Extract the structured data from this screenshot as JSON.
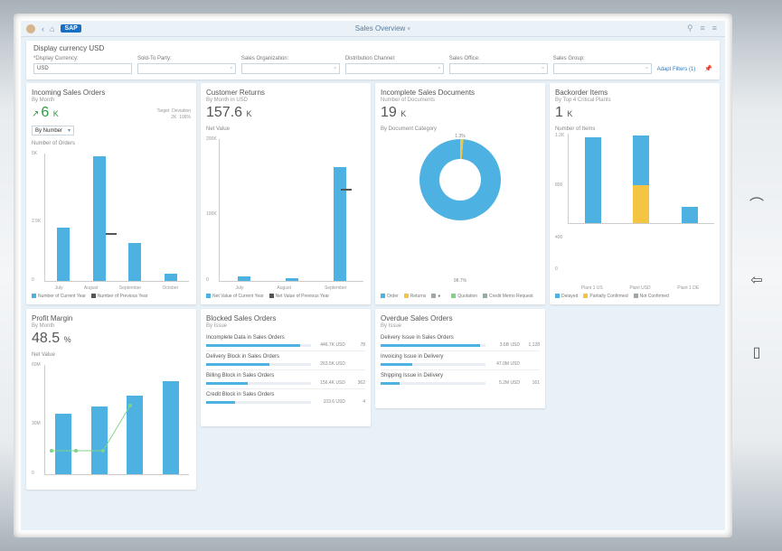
{
  "topbar": {
    "title": "Sales Overview",
    "sap": "SAP"
  },
  "filterbar": {
    "header": "Display currency USD",
    "fields": [
      {
        "label": "*Display Currency:",
        "value": "USD"
      },
      {
        "label": "Sold-To Party:",
        "value": ""
      },
      {
        "label": "Sales Organization:",
        "value": ""
      },
      {
        "label": "Distribution Channel:",
        "value": ""
      },
      {
        "label": "Sales Office:",
        "value": ""
      },
      {
        "label": "Sales Group:",
        "value": ""
      }
    ],
    "adapt": "Adapt Filters (1)"
  },
  "cards": {
    "incoming": {
      "title": "Incoming Sales Orders",
      "sub": "By Month",
      "kpi": "6",
      "unit": "K",
      "meta_labels": [
        "Target",
        "Deviation"
      ],
      "meta_values": [
        "2K",
        "196%"
      ],
      "selector": "By Number",
      "axis_label": "Number of Orders",
      "yticks": [
        "5K",
        "2.5K",
        "0"
      ],
      "bars": [
        {
          "l": "July",
          "v": 42
        },
        {
          "l": "August",
          "v": 98
        },
        {
          "l": "September",
          "v": 30
        },
        {
          "l": "October",
          "v": 6
        }
      ],
      "legend": [
        "Number of Current Year",
        "Number of Previous Year"
      ]
    },
    "returns": {
      "title": "Customer Returns",
      "sub": "By Month in USD",
      "kpi": "157.6",
      "unit": "K",
      "axis_label": "Net Value",
      "yticks": [
        "200K",
        "100K",
        "0"
      ],
      "bars": [
        {
          "l": "July",
          "v": 3
        },
        {
          "l": "August",
          "v": 2
        },
        {
          "l": "September",
          "v": 80
        }
      ],
      "legend": [
        "Net Value of Current Year",
        "Net Value of Previous Year"
      ]
    },
    "incomplete": {
      "title": "Incomplete Sales Documents",
      "sub": "Number of Documents",
      "kpi": "19",
      "unit": "K",
      "axis_label": "By Document Category",
      "slices": [
        {
          "label": "98.7%"
        },
        {
          "label": "1.3%"
        }
      ],
      "legend": [
        "Order",
        "Returns",
        "Quotation",
        "Credit Memo Request"
      ]
    },
    "backorder": {
      "title": "Backorder Items",
      "sub": "By Top 4 Critical Plants",
      "kpi": "1",
      "unit": "K",
      "axis_label": "Number of Items",
      "yticks": [
        "1.2K",
        "800",
        "400",
        "0"
      ],
      "cols": [
        {
          "l": "Plant 1 US",
          "b": 95,
          "y": 0
        },
        {
          "l": "Plant USD",
          "b": 55,
          "y": 42
        },
        {
          "l": "Plant 1 DE",
          "b": 18,
          "y": 0
        }
      ],
      "legend": [
        "Delayed",
        "Partially Confirmed",
        "Not Confirmed"
      ]
    },
    "profit": {
      "title": "Profit Margin",
      "sub": "By Month",
      "kpi": "48.5",
      "unit": "%",
      "axis_label": "Net Value",
      "yticks": [
        "60M",
        "30M",
        "0"
      ],
      "bars": [
        {
          "v": 55
        },
        {
          "v": 62
        },
        {
          "v": 72
        },
        {
          "v": 85
        }
      ]
    },
    "blocked": {
      "title": "Blocked Sales Orders",
      "sub": "By Issue",
      "items": [
        {
          "name": "Incomplete Data in Sales Orders",
          "val": "446.7K USD",
          "cnt": "78",
          "pct": 90
        },
        {
          "name": "Delivery Block in Sales Orders",
          "val": "263.5K USD",
          "cnt": "",
          "pct": 60
        },
        {
          "name": "Billing Block in Sales Orders",
          "val": "156.4K USD",
          "cnt": "362",
          "pct": 40
        },
        {
          "name": "Credit Block in Sales Orders",
          "val": "103.6 USD",
          "cnt": "4",
          "pct": 28
        }
      ]
    },
    "overdue": {
      "title": "Overdue Sales Orders",
      "sub": "By Issue",
      "items": [
        {
          "name": "Delivery Issue in Sales Orders",
          "val": "3.6B USD",
          "cnt": "1,128",
          "pct": 95
        },
        {
          "name": "Invoicing Issue in Delivery",
          "val": "47.0M USD",
          "cnt": "",
          "pct": 30
        },
        {
          "name": "Shipping Issue in Delivery",
          "val": "5.2M USD",
          "cnt": "161",
          "pct": 18
        }
      ]
    }
  },
  "chart_data": [
    {
      "type": "bar",
      "title": "Incoming Sales Orders — Number of Orders",
      "categories": [
        "July",
        "August",
        "September",
        "October"
      ],
      "series": [
        {
          "name": "Number of Current Year",
          "values": [
            2100,
            4900,
            1500,
            300
          ]
        }
      ],
      "ylim": [
        0,
        5000
      ],
      "ylabel": "Number of Orders"
    },
    {
      "type": "bar",
      "title": "Customer Returns — Net Value",
      "categories": [
        "July",
        "August",
        "September"
      ],
      "series": [
        {
          "name": "Net Value of Current Year",
          "values": [
            6000,
            4000,
            160000
          ]
        }
      ],
      "ylim": [
        0,
        200000
      ],
      "ylabel": "Net Value (USD)"
    },
    {
      "type": "pie",
      "title": "Incomplete Sales Documents — By Document Category",
      "categories": [
        "Order",
        "Returns",
        "Quotation",
        "Credit Memo Request"
      ],
      "values": [
        98.7,
        1.3,
        0,
        0
      ]
    },
    {
      "type": "bar",
      "title": "Backorder Items — Number of Items",
      "categories": [
        "Plant 1 US",
        "Plant USD",
        "Plant 1 DE"
      ],
      "series": [
        {
          "name": "Delayed",
          "values": [
            1150,
            650,
            220
          ]
        },
        {
          "name": "Partially Confirmed",
          "values": [
            0,
            500,
            0
          ]
        },
        {
          "name": "Not Confirmed",
          "values": [
            0,
            0,
            0
          ]
        }
      ],
      "ylim": [
        0,
        1200
      ]
    },
    {
      "type": "bar",
      "title": "Profit Margin — Net Value",
      "categories": [
        "",
        "",
        "",
        ""
      ],
      "values": [
        33000000,
        37000000,
        43000000,
        51000000
      ],
      "ylim": [
        0,
        60000000
      ],
      "ylabel": "Net Value"
    }
  ]
}
